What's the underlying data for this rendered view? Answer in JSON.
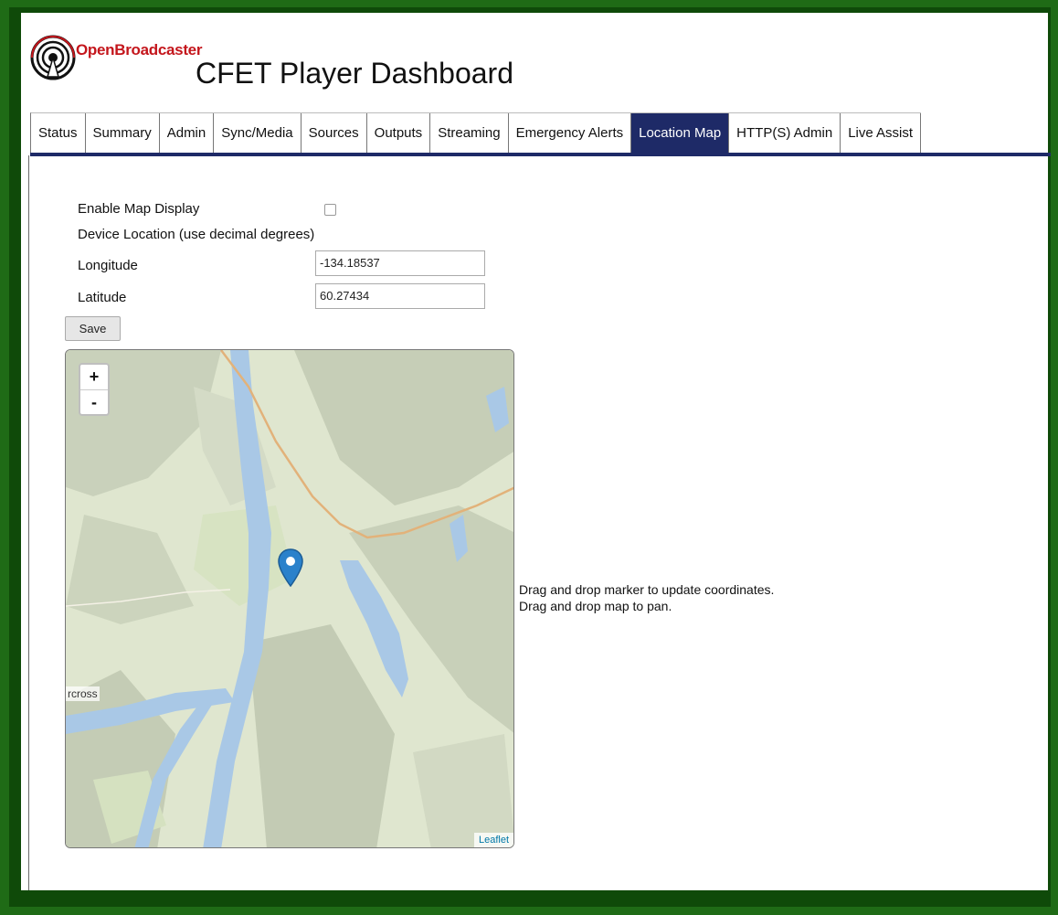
{
  "header": {
    "brand": "OpenBroadcaster",
    "title": "CFET Player Dashboard",
    "logo_icon": "radio-tower-icon"
  },
  "tabs": [
    {
      "label": "Status",
      "active": false
    },
    {
      "label": "Summary",
      "active": false
    },
    {
      "label": "Admin",
      "active": false
    },
    {
      "label": "Sync/Media",
      "active": false
    },
    {
      "label": "Sources",
      "active": false
    },
    {
      "label": "Outputs",
      "active": false
    },
    {
      "label": "Streaming",
      "active": false
    },
    {
      "label": "Emergency Alerts",
      "active": false
    },
    {
      "label": "Location Map",
      "active": true
    },
    {
      "label": "HTTP(S) Admin",
      "active": false
    },
    {
      "label": "Live Assist",
      "active": false
    }
  ],
  "form": {
    "enable_map_label": "Enable Map Display",
    "enable_map_checked": false,
    "device_location_label": "Device Location (use decimal degrees)",
    "longitude_label": "Longitude",
    "longitude_value": "-134.18537",
    "latitude_label": "Latitude",
    "latitude_value": "60.27434",
    "save_label": "Save"
  },
  "map": {
    "zoom_in": "+",
    "zoom_out": "-",
    "place_label": "rcross",
    "attribution": "Leaflet",
    "marker_icon": "map-pin-icon"
  },
  "hints": {
    "drag_marker": "Drag and drop marker to update coordinates.",
    "drag_map": "Drag and drop map to pan."
  },
  "colors": {
    "accent": "#1e2a67",
    "brand_red": "#c4161c",
    "frame_green": "#1f6b16",
    "marker_blue": "#2a81cb"
  }
}
